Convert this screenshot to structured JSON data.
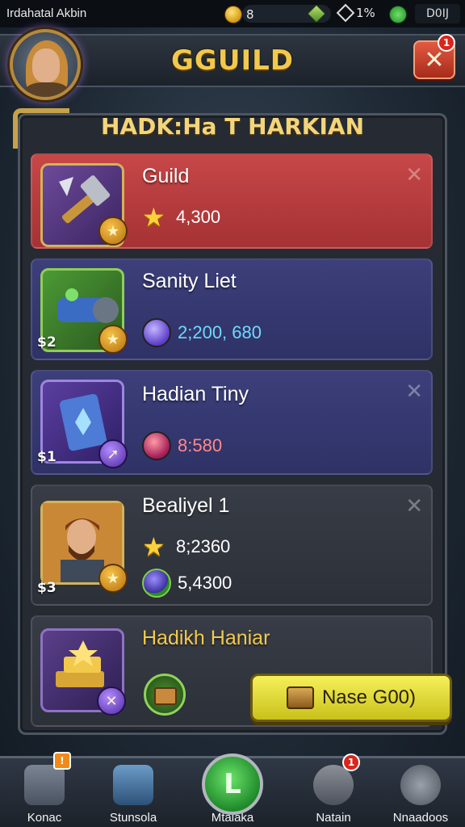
{
  "status_bar": {
    "title": "Irdahatal Akbin",
    "coins": "8",
    "percent": "1%",
    "box": "D0IJ"
  },
  "header": {
    "title": "GGUILD",
    "close_icon": "close-icon",
    "notification_count": "1"
  },
  "section": {
    "title": "HADK:Ha T HARKIAN"
  },
  "cards": [
    {
      "name": "Guild",
      "stat1": "4,300",
      "icon": "hammer-icon",
      "price": ""
    },
    {
      "name": "Sanity Liet",
      "stat1": "2;200, 680",
      "icon": "cannon-icon",
      "price": "$2"
    },
    {
      "name": "Hadian Tiny",
      "stat1": "8:580",
      "icon": "shield-scroll-icon",
      "price": "$1"
    },
    {
      "name": "Bealiyel 1",
      "stat1": "8;2360",
      "stat2": "5,4300",
      "icon": "hero-portrait-icon",
      "price": "$3"
    },
    {
      "name": "Hadikh Haniar",
      "button_label": "Nase G00)",
      "icon": "gold-bars-icon"
    }
  ],
  "bottom_nav": [
    {
      "label": "Konac",
      "badge": "!"
    },
    {
      "label": "Stunsola",
      "badge": ""
    },
    {
      "label": "Mtaiaka",
      "badge": ""
    },
    {
      "label": "Natain",
      "badge": "1"
    },
    {
      "label": "Nnaadoos",
      "badge": ""
    }
  ],
  "colors": {
    "gold": "#f2c94c",
    "red_card": "#c74747",
    "blue_card": "#3c3f7a",
    "button_yellow": "#f6f05a"
  }
}
